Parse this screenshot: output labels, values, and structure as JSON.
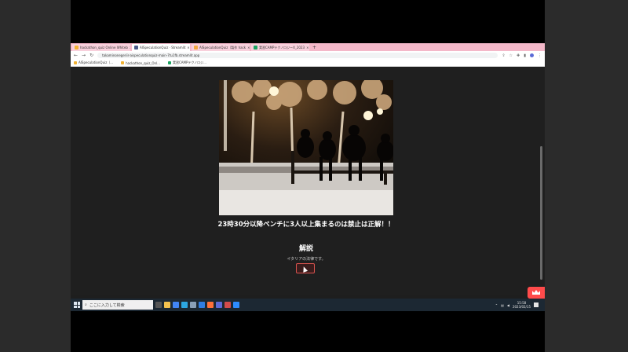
{
  "tabs": [
    {
      "label": "hackathon_quiz Online Whiteb",
      "color": "#f2b233",
      "active": false
    },
    {
      "label": "AISpeculationQuiz · Streamlit",
      "color": "#4a5a8a",
      "active": true
    },
    {
      "label": "AISpeculationQuiz（製作 hack",
      "color": "#f4a740",
      "active": false
    },
    {
      "label": "実習CAMPテクノロジーX_2023",
      "color": "#1aa260",
      "active": false
    }
  ],
  "browser": {
    "url": "takaminonegeriir-aispeculationquiz-main-7tu1fb.streamlit.app",
    "new_tab": "+"
  },
  "bookmarks": [
    {
      "label": "AISpeculationQuiz（...",
      "color": "#f2b233"
    },
    {
      "label": "hackathon_quiz_Onl...",
      "color": "#f2b233"
    },
    {
      "label": "実習CAMPテクノロジ...",
      "color": "#1aa260"
    }
  ],
  "quiz": {
    "headline": "23時30分以降ベンチに3人以上集まるのは禁止は正解！！",
    "explanation_title": "解説",
    "explanation_text": "イタリアの法律です。"
  },
  "taskbar": {
    "search_placeholder": "ここに入力して検索",
    "time": "15:58",
    "date": "2023/02/15"
  },
  "colors": {
    "accent": "#ff4b4b",
    "tab_bar": "#f4b8c9",
    "page_bg": "#1f1f1f"
  }
}
